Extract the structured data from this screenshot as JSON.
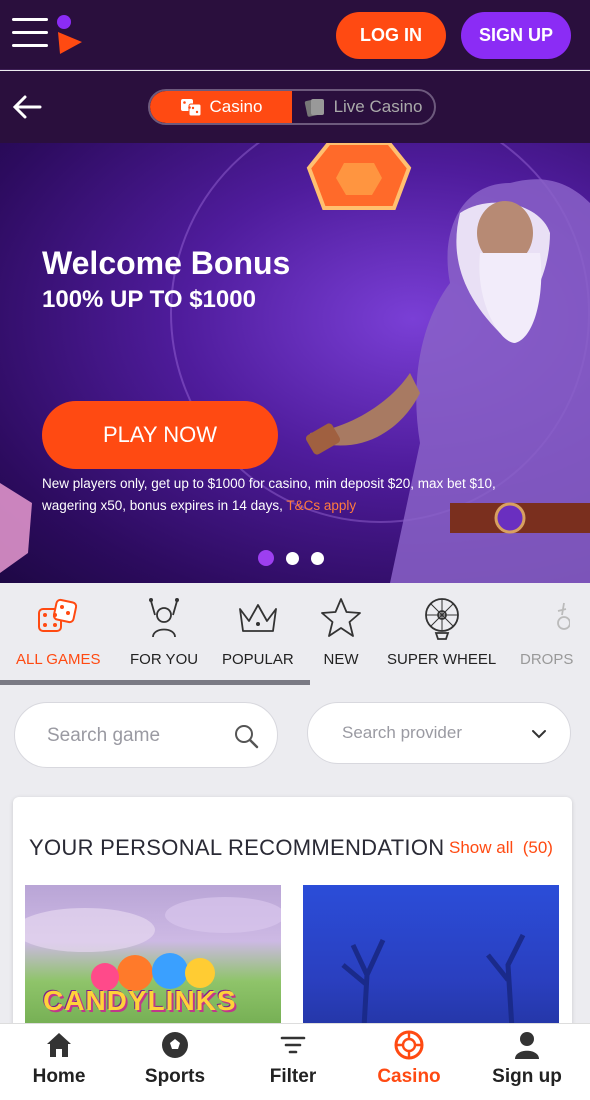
{
  "header": {
    "login_label": "LOG IN",
    "signup_label": "SIGN UP"
  },
  "mode_toggle": {
    "casino_label": "Casino",
    "live_label": "Live Casino"
  },
  "hero": {
    "title": "Welcome Bonus",
    "subtitle": "100% UP TO $1000",
    "cta_label": "PLAY NOW",
    "terms_text": "New players only, get up to $1000 for casino, min deposit $20, max bet $10, wagering x50, bonus expires in 14 days, ",
    "terms_link": "T&Cs apply",
    "slides_total": 3,
    "active_slide": 1
  },
  "categories": [
    {
      "label": "ALL GAMES",
      "icon": "dice-icon",
      "active": true
    },
    {
      "label": "FOR YOU",
      "icon": "person-cheer-icon",
      "active": false
    },
    {
      "label": "POPULAR",
      "icon": "crown-icon",
      "active": false
    },
    {
      "label": "NEW",
      "icon": "star-icon",
      "active": false
    },
    {
      "label": "SUPER WHEEL",
      "icon": "wheel-icon",
      "active": false
    },
    {
      "label": "DROPS",
      "icon": "drops-icon",
      "active": false
    }
  ],
  "search": {
    "game_placeholder": "Search game",
    "provider_placeholder": "Search provider"
  },
  "recommendations": {
    "title": "YOUR PERSONAL RECOMMENDATION",
    "show_all_label": "Show all",
    "count": "(50)",
    "games": [
      {
        "title": "CANDYLINKS"
      },
      {
        "title": ""
      }
    ]
  },
  "bottom_nav": [
    {
      "label": "Home",
      "icon": "home-icon",
      "active": false
    },
    {
      "label": "Sports",
      "icon": "soccer-ball-icon",
      "active": false
    },
    {
      "label": "Filter",
      "icon": "filter-icon",
      "active": false
    },
    {
      "label": "Casino",
      "icon": "casino-chip-icon",
      "active": true
    },
    {
      "label": "Sign up",
      "icon": "user-icon",
      "active": false
    }
  ],
  "colors": {
    "brand_orange": "#ff4a12",
    "brand_purple": "#8b2cf5",
    "header_bg": "#2a0f3d"
  }
}
